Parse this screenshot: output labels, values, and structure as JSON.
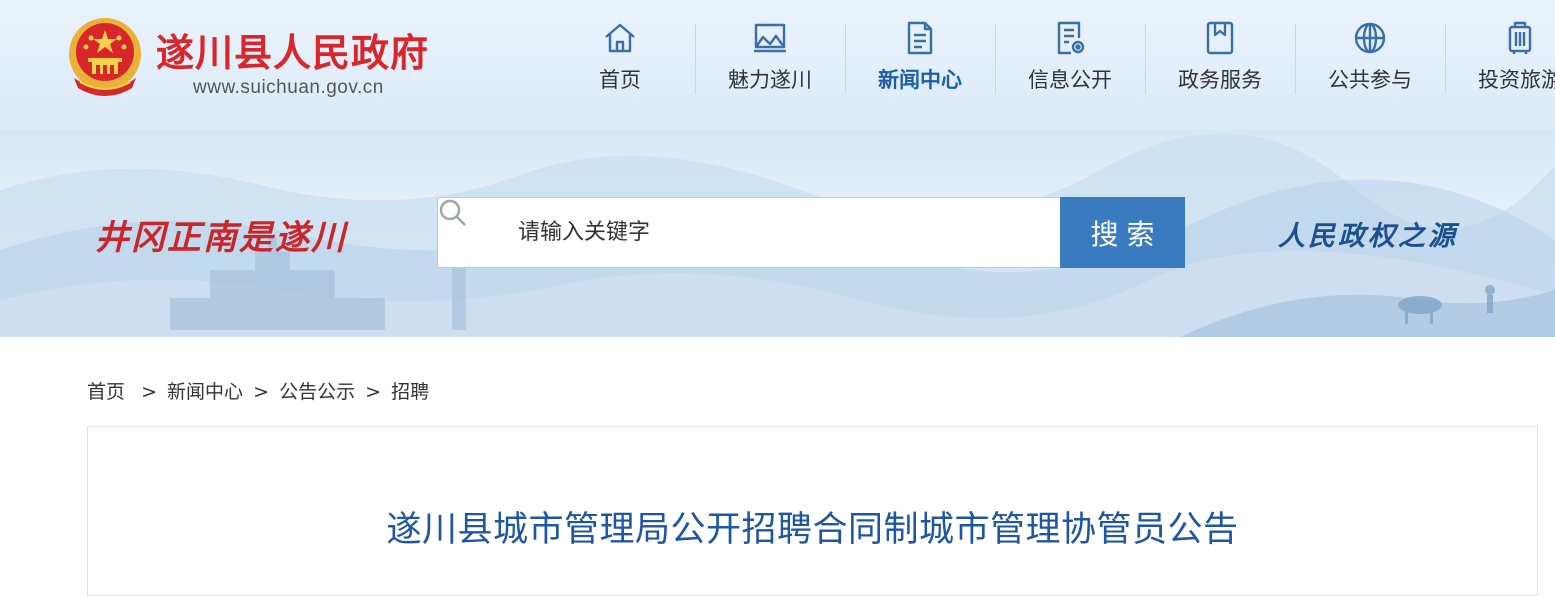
{
  "header": {
    "site_title": "遂川县人民政府",
    "site_url": "www.suichuan.gov.cn",
    "logo_icon": "national-emblem-icon"
  },
  "nav": {
    "items": [
      {
        "label": "首页",
        "icon": "home-icon",
        "active": false
      },
      {
        "label": "魅力遂川",
        "icon": "landscape-frame-icon",
        "active": false
      },
      {
        "label": "新闻中心",
        "icon": "document-icon",
        "active": true
      },
      {
        "label": "信息公开",
        "icon": "document-gear-icon",
        "active": false
      },
      {
        "label": "政务服务",
        "icon": "bookmark-icon",
        "active": false
      },
      {
        "label": "公共参与",
        "icon": "globe-icon",
        "active": false
      },
      {
        "label": "投资旅游",
        "icon": "luggage-icon",
        "active": false
      }
    ]
  },
  "banner": {
    "slogan_left": "井冈正南是遂川",
    "slogan_right": "人民政权之源"
  },
  "search": {
    "placeholder": "请输入关键字",
    "button_label": "搜索"
  },
  "breadcrumb": {
    "items": [
      "首页",
      "新闻中心",
      "公告公示",
      "招聘"
    ],
    "separator": ">"
  },
  "article": {
    "title": "遂川县城市管理局公开招聘合同制城市管理协管员公告"
  },
  "colors": {
    "brand_red": "#d8262a",
    "accent_blue": "#3a7bbf",
    "title_blue": "#1f55a5"
  }
}
